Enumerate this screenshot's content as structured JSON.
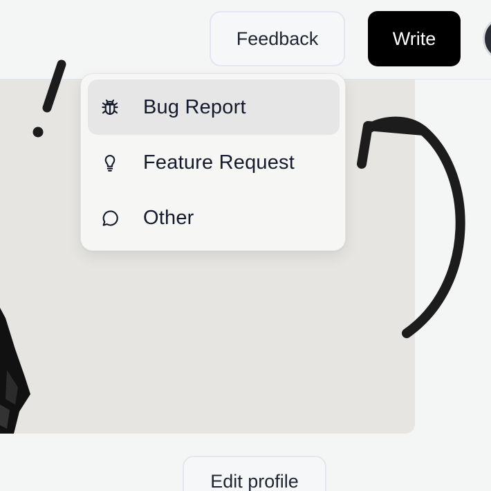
{
  "header": {
    "feedback_label": "Feedback",
    "write_label": "Write"
  },
  "feedback_menu": {
    "items": [
      {
        "label": "Bug Report",
        "icon": "bug-icon",
        "active": true
      },
      {
        "label": "Feature Request",
        "icon": "lightbulb-icon",
        "active": false
      },
      {
        "label": "Other",
        "icon": "chat-bubble-icon",
        "active": false
      }
    ]
  },
  "profile": {
    "edit_label": "Edit profile"
  },
  "colors": {
    "write_button_bg": "#000000",
    "menu_active_bg": "#e6e6e6",
    "cover_bg": "#e6e5e2",
    "text": "#141a2b"
  }
}
